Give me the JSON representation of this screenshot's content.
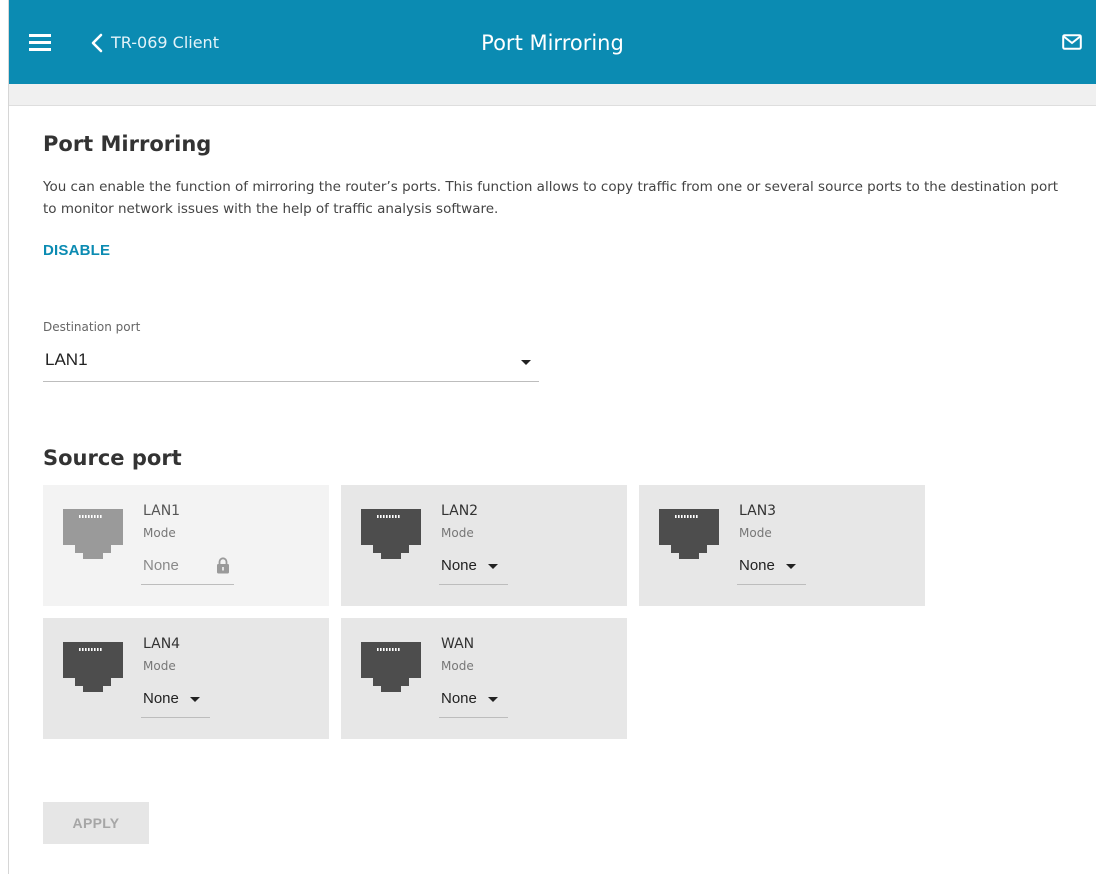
{
  "header": {
    "back_label": "TR-069 Client",
    "title": "Port Mirroring",
    "icons": {
      "menu": "hamburger-menu-icon",
      "back": "chevron-left-icon",
      "notifications": "mail-icon"
    },
    "color": "#0b8bb2"
  },
  "section": {
    "title": "Port Mirroring",
    "description": "You can enable the function of mirroring the router’s ports. This function allows to copy traffic from one or several source ports to the destination port to monitor network issues with the help of traffic analysis software.",
    "toggle_label": "DISABLE"
  },
  "destination": {
    "label": "Destination port",
    "value": "LAN1"
  },
  "source": {
    "title": "Source port",
    "ports": [
      {
        "name": "LAN1",
        "mode_label": "Mode",
        "mode_value": "None",
        "locked": true
      },
      {
        "name": "LAN2",
        "mode_label": "Mode",
        "mode_value": "None",
        "locked": false
      },
      {
        "name": "LAN3",
        "mode_label": "Mode",
        "mode_value": "None",
        "locked": false
      },
      {
        "name": "LAN4",
        "mode_label": "Mode",
        "mode_value": "None",
        "locked": false
      },
      {
        "name": "WAN",
        "mode_label": "Mode",
        "mode_value": "None",
        "locked": false
      }
    ]
  },
  "footer": {
    "apply_label": "APPLY",
    "apply_enabled": false
  }
}
